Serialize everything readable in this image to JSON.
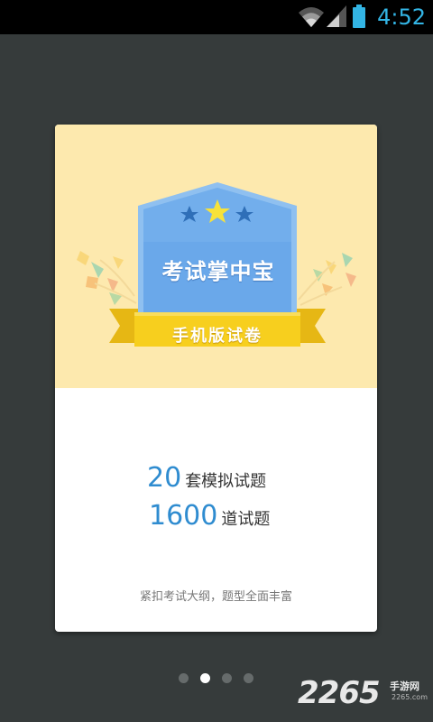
{
  "status_bar": {
    "time": "4:52",
    "icons": [
      "wifi-icon",
      "signal-icon",
      "battery-icon"
    ],
    "accent_color": "#33b5e5"
  },
  "card": {
    "badge_title": "考试掌中宝",
    "ribbon_text": "手机版试卷",
    "stats": [
      {
        "number": "20",
        "label": "套模拟试题"
      },
      {
        "number": "1600",
        "label": "道试题"
      }
    ],
    "footer": "紧扣考试大纲，题型全面丰富",
    "colors": {
      "top_background": "#fde9ae",
      "badge_blue": "#6aa8ea",
      "ribbon_yellow": "#f7cf1e",
      "number_blue": "#2f8cd0"
    }
  },
  "pager": {
    "total_pages": 4,
    "current_page": 2
  },
  "watermark": {
    "number": "2265",
    "site": "手游网",
    "domain": "2265.com"
  }
}
